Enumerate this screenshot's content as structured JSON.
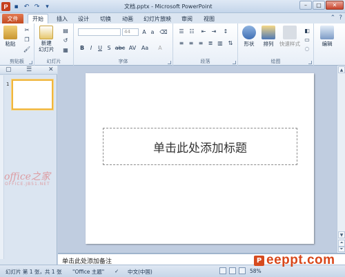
{
  "window": {
    "title": "文档.pptx - Microsoft PowerPoint",
    "app_icon_letter": "P",
    "controls": {
      "minimize": "–",
      "maximize": "□",
      "close": "✕"
    }
  },
  "tabs": [
    "文件",
    "开始",
    "插入",
    "设计",
    "切换",
    "动画",
    "幻灯片放映",
    "审阅",
    "视图"
  ],
  "ribbon": {
    "clipboard": {
      "label": "剪贴板",
      "paste": "粘贴"
    },
    "slides": {
      "label": "幻灯片",
      "new_slide": "新建\n幻灯片"
    },
    "font": {
      "label": "字体",
      "size": "44",
      "bold": "B",
      "italic": "I",
      "underline": "U",
      "strike": "S",
      "shadow": "abc",
      "spacing": "AV",
      "case": "Aa",
      "color": "A"
    },
    "paragraph": {
      "label": "段落"
    },
    "drawing": {
      "label": "绘图",
      "shapes": "形状",
      "arrange": "排列",
      "quick_styles": "快速样式"
    },
    "editing": {
      "label": "编辑"
    }
  },
  "panel": {
    "thumb_number": "1",
    "watermark": "office之家",
    "watermark_sub": "OFFICE.JB51.NET"
  },
  "slide": {
    "title_placeholder": "单击此处添加标题"
  },
  "notes": {
    "placeholder": "单击此处添加备注"
  },
  "status": {
    "slide_info": "幻灯片 第 1 张，共 1 张",
    "theme": "\"Office 主题\"",
    "language": "中文(中国)",
    "zoom": "58%"
  },
  "brand": {
    "logo_letter": "P",
    "text": "eeppt.com"
  }
}
